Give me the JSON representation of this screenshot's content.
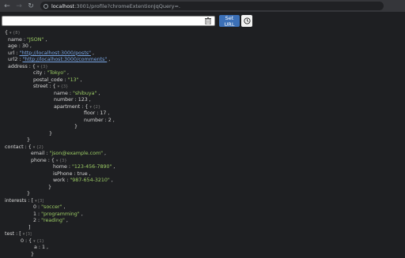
{
  "browser": {
    "url_host": "localhost",
    "url_path": ":3001/profile?chromeExtentionJqQuery=."
  },
  "toolbar": {
    "input_value": "",
    "set_url_label": "Set URL"
  },
  "json": {
    "root_badge": "▾ {8}",
    "name_key": "name",
    "name_val": "\"JSON\"",
    "age_key": "age",
    "age_val": "30",
    "url_key": "url",
    "url_val": "\"http://localhost:3000/posts\"",
    "url2_key": "url2",
    "url2_val": "\"http://localhost:3000/comments\"",
    "address_key": "address",
    "address_badge": "▾ {3}",
    "city_key": "city",
    "city_val": "\"Tokyo\"",
    "postal_key": "postal_code",
    "postal_val": "\"13\"",
    "street_key": "street",
    "street_badge": "▾ {3}",
    "sname_key": "name",
    "sname_val": "\"shibuya\"",
    "number_key": "number",
    "number_val": "123",
    "apartment_key": "apartment",
    "apartment_badge": "▾ {2}",
    "floor_key": "floor",
    "floor_val": "17",
    "anumber_key": "number",
    "anumber_val": "2",
    "contact_key": "contact",
    "contact_badge": "▾ {2}",
    "email_key": "email",
    "email_val": "\"json@example.com\"",
    "phone_key": "phone",
    "phone_badge": "▾ {3}",
    "home_key": "home",
    "home_val": "\"123-456-7890\"",
    "isphone_key": "isPhone",
    "isphone_val": "true",
    "work_key": "work",
    "work_val": "\"987-654-3210\"",
    "interests_key": "interests",
    "interests_badge": "▾ [3]",
    "i0_key": "0",
    "i0_val": "\"soccer\"",
    "i1_key": "1",
    "i1_val": "\"programming\"",
    "i2_key": "2",
    "i2_val": "\"reading\"",
    "test_key": "test",
    "test_badge": "▾ [3]",
    "t0_key": "0",
    "t0_badge": "▾ {1}",
    "a_key": "a",
    "a_val": "1"
  }
}
